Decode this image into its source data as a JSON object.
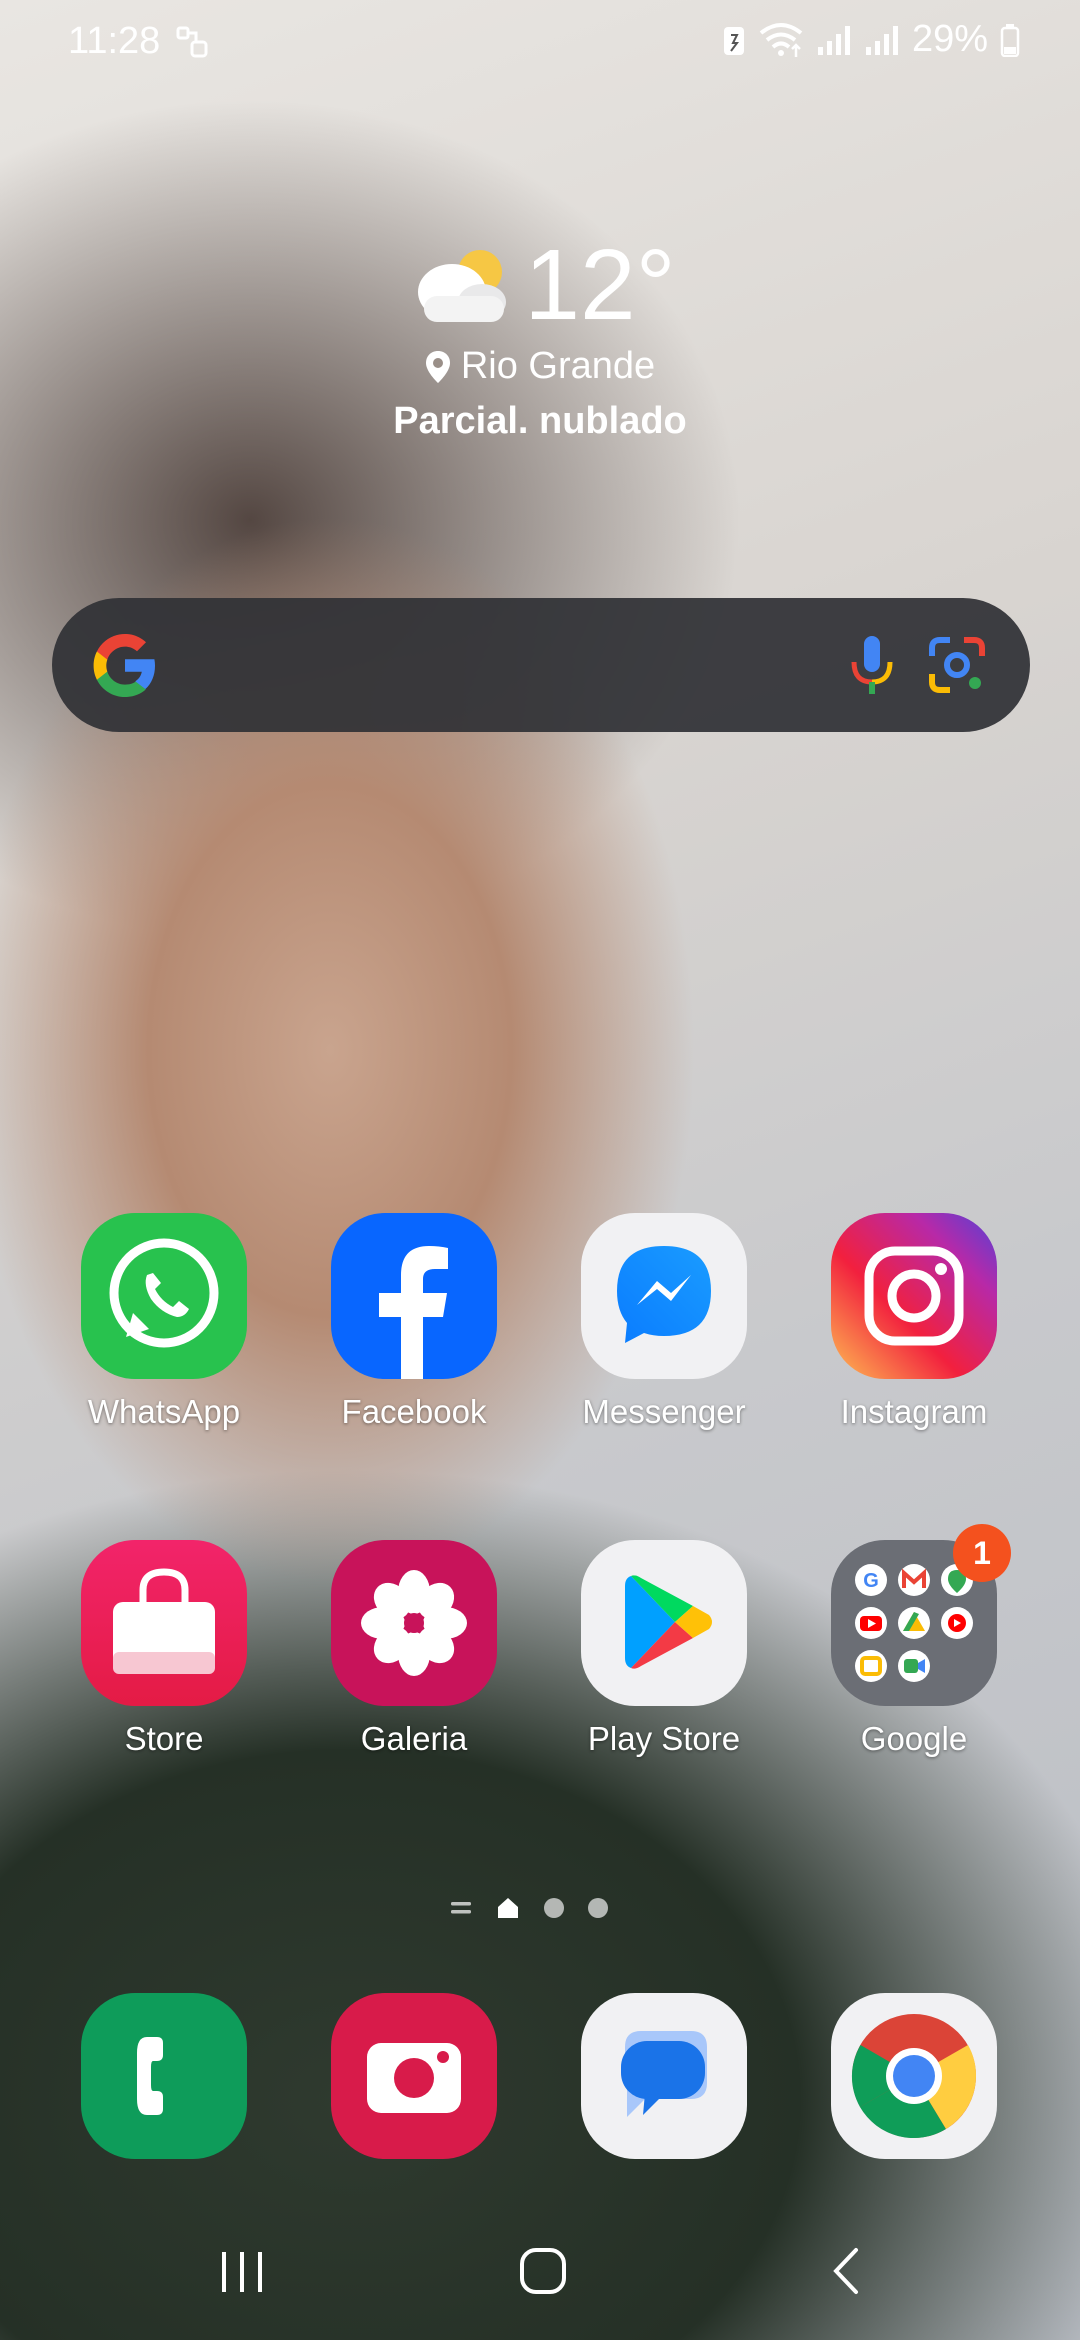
{
  "status_bar": {
    "time": "11:28",
    "battery_percent": "29%",
    "icons": [
      "notification-icon",
      "battery-saver-icon",
      "wifi-icon",
      "signal-icon",
      "signal-icon-2",
      "battery-icon"
    ]
  },
  "weather": {
    "temperature": "12°",
    "location": "Rio Grande",
    "condition": "Parcial. nublado",
    "icon": "partly-cloudy-icon"
  },
  "search": {
    "icons": [
      "google-logo",
      "mic-icon",
      "lens-icon"
    ]
  },
  "apps": [
    {
      "label": "WhatsApp",
      "icon": "whatsapp-icon",
      "color": "#25D366"
    },
    {
      "label": "Facebook",
      "icon": "facebook-icon",
      "color": "#0866FF"
    },
    {
      "label": "Messenger",
      "icon": "messenger-icon",
      "color": "#0A7CFF"
    },
    {
      "label": "Instagram",
      "icon": "instagram-icon",
      "color": "#E1306C"
    },
    {
      "label": "Store",
      "icon": "store-icon",
      "color": "#E8175D"
    },
    {
      "label": "Galeria",
      "icon": "gallery-icon",
      "color": "#C2185B"
    },
    {
      "label": "Play Store",
      "icon": "play-store-icon",
      "color": "#01875F"
    },
    {
      "label": "Google",
      "icon": "google-folder-icon",
      "color": "#6B6E75",
      "badge": "1"
    }
  ],
  "dock": [
    {
      "icon": "phone-icon",
      "color": "#0E9C5A"
    },
    {
      "icon": "camera-icon",
      "color": "#D81B4A"
    },
    {
      "icon": "messages-icon",
      "color": "#1A73E8"
    },
    {
      "icon": "chrome-icon",
      "color": "#4285F4"
    }
  ],
  "page_indicator": {
    "pages": 4,
    "current": 1
  },
  "nav": {
    "icons": [
      "recents-icon",
      "home-icon",
      "back-icon"
    ]
  }
}
